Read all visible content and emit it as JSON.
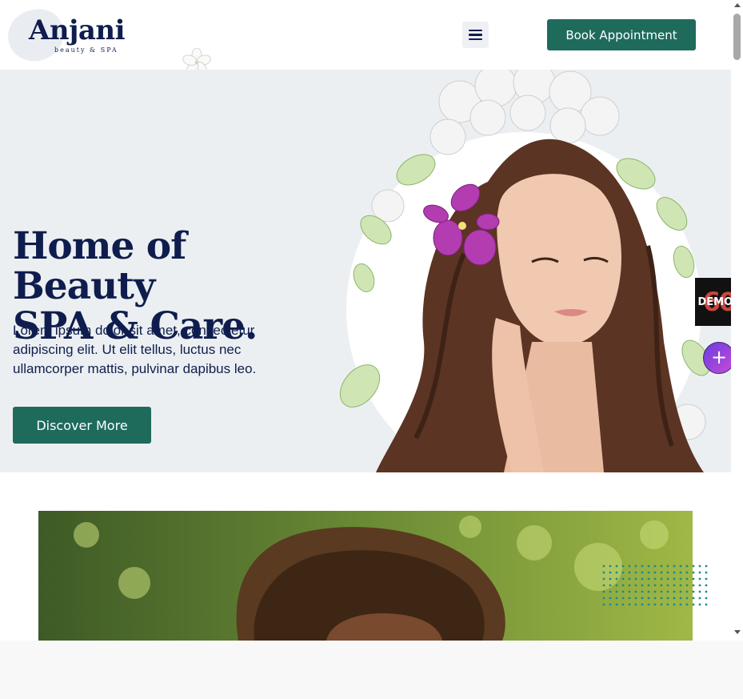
{
  "header": {
    "logo_name": "Anjani",
    "logo_tagline": "beauty & SPA",
    "book_button_label": "Book Appointment"
  },
  "hero": {
    "title_line1": "Home of Beauty",
    "title_line2": "SPA & Care.",
    "description": "Lorem ipsum dolor sit amet, consectetur adipiscing elit. Ut elit tellus, luctus nec ullamcorper mattis, pulvinar dapibus leo.",
    "discover_button_label": "Discover More"
  },
  "widgets": {
    "demos_count": "60",
    "demos_label": "DEMOS",
    "plus_label": "+"
  },
  "colors": {
    "accent_green": "#1e6b5c",
    "navy_text": "#0f1d4e",
    "hero_bg": "#eceff2"
  }
}
